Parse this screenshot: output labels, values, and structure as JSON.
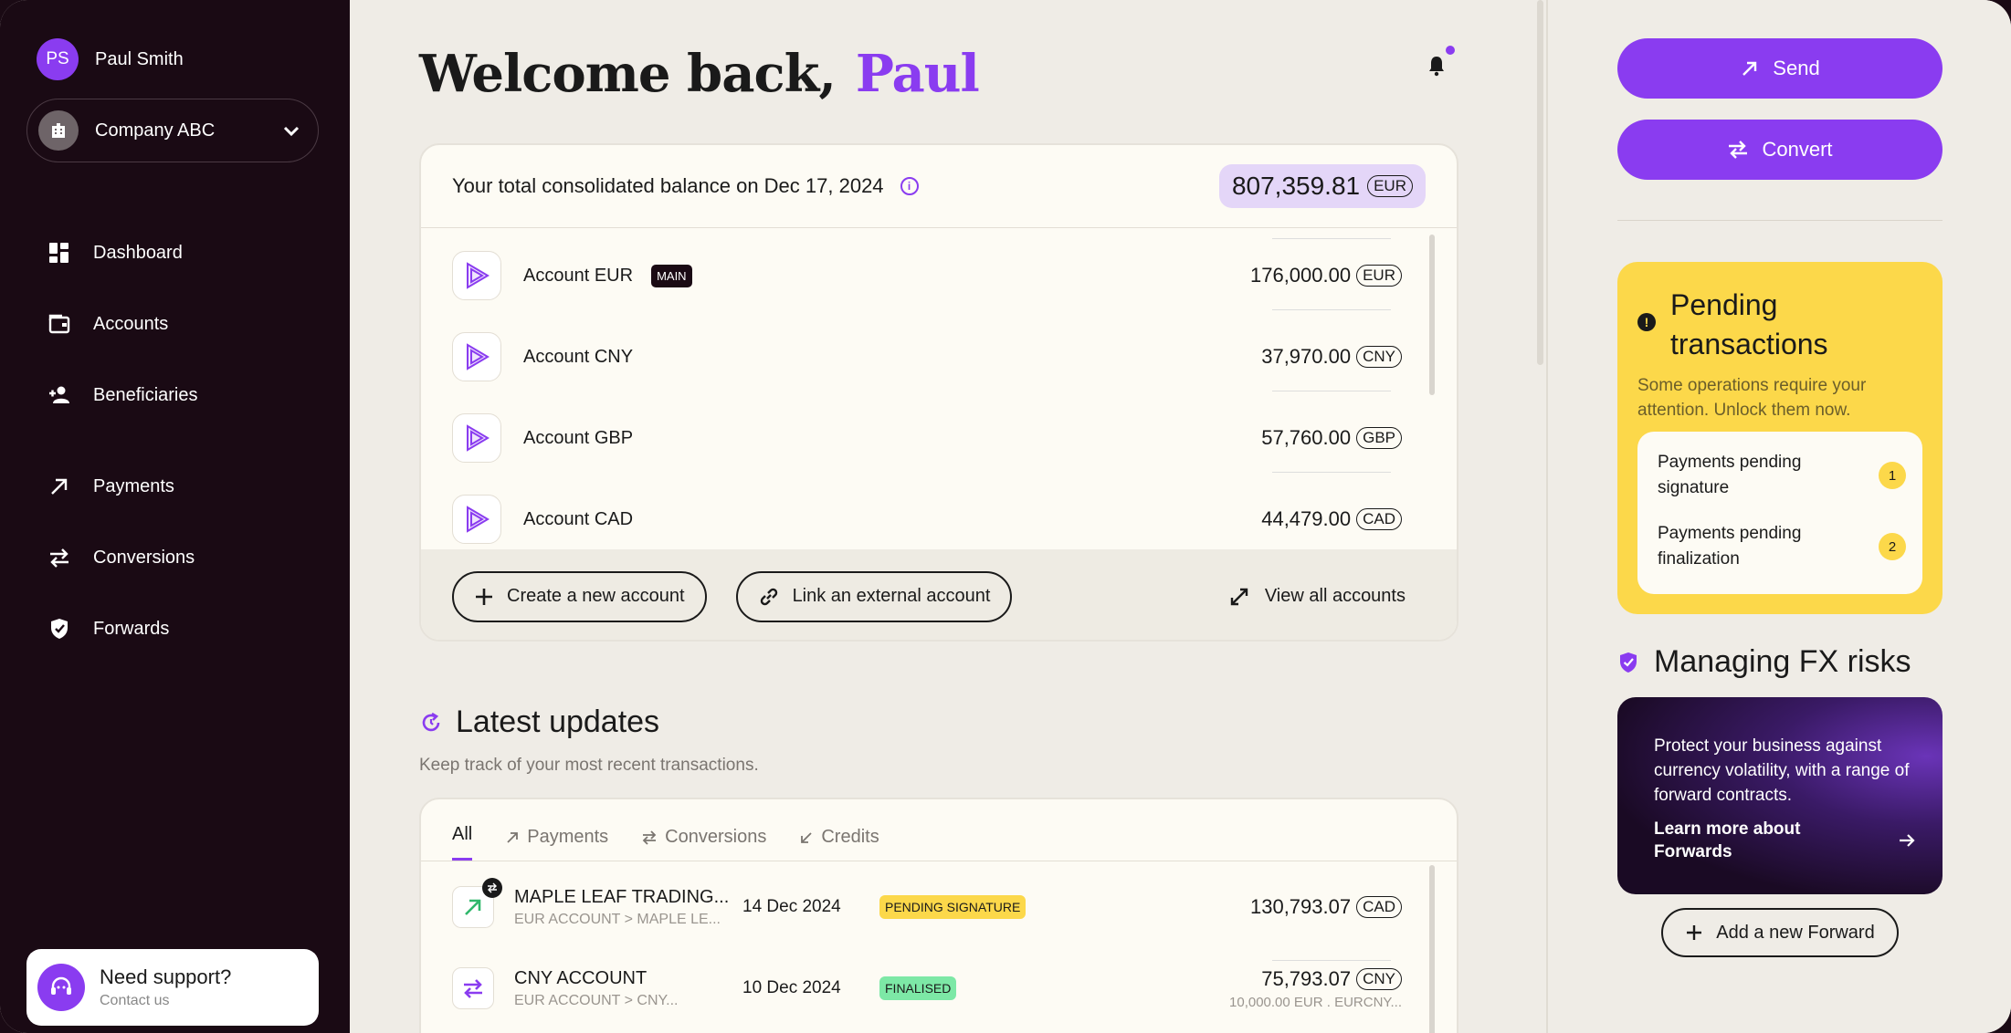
{
  "user": {
    "initials": "PS",
    "name": "Paul Smith"
  },
  "company": {
    "name": "Company ABC"
  },
  "nav": [
    {
      "label": "Dashboard"
    },
    {
      "label": "Accounts"
    },
    {
      "label": "Beneficiaries"
    },
    {
      "label": "Payments"
    },
    {
      "label": "Conversions"
    },
    {
      "label": "Forwards"
    }
  ],
  "support": {
    "title": "Need support?",
    "subtitle": "Contact us"
  },
  "header": {
    "welcome": "Welcome back,",
    "name": "Paul"
  },
  "balance": {
    "label": "Your total consolidated balance on Dec 17, 2024",
    "amount": "807,359.81",
    "currency": "EUR"
  },
  "accounts": [
    {
      "name": "Account EUR",
      "badge": "MAIN",
      "amount": "176,000.00",
      "currency": "EUR"
    },
    {
      "name": "Account CNY",
      "amount": "37,970.00",
      "currency": "CNY"
    },
    {
      "name": "Account GBP",
      "amount": "57,760.00",
      "currency": "GBP"
    },
    {
      "name": "Account CAD",
      "amount": "44,479.00",
      "currency": "CAD"
    }
  ],
  "account_actions": {
    "create": "Create a new account",
    "link": "Link an external account",
    "view_all": "View all accounts"
  },
  "updates": {
    "title": "Latest updates",
    "subtitle": "Keep track of your most recent transactions.",
    "tabs": [
      {
        "label": "All"
      },
      {
        "label": "Payments"
      },
      {
        "label": "Conversions"
      },
      {
        "label": "Credits"
      }
    ],
    "transactions": [
      {
        "name": "MAPLE LEAF TRADING...",
        "sub": "EUR ACCOUNT > MAPLE LE...",
        "date": "14 Dec 2024",
        "status": "PENDING SIGNATURE",
        "status_color": "#fcd84a",
        "amount": "130,793.07",
        "currency": "CAD",
        "amount_sub": ""
      },
      {
        "name": "CNY ACCOUNT",
        "sub": "EUR ACCOUNT > CNY...",
        "date": "10 Dec 2024",
        "status": "FINALISED",
        "status_color": "#7de8a6",
        "amount": "75,793.07",
        "currency": "CNY",
        "amount_sub": "10,000.00 EUR . EURCNY..."
      }
    ]
  },
  "actions": {
    "send": "Send",
    "convert": "Convert"
  },
  "pending": {
    "title_line1": "Pending",
    "title_line2": "transactions",
    "subtitle": "Some operations require your attention. Unlock them now.",
    "items": [
      {
        "label": "Payments pending signature",
        "count": "1"
      },
      {
        "label": "Payments pending finalization",
        "count": "2"
      }
    ]
  },
  "fx": {
    "title": "Managing FX risks",
    "text": "Protect your business against currency volatility, with a range of forward contracts.",
    "link": "Learn more about Forwards",
    "add_button": "Add a new Forward"
  },
  "colors": {
    "accent": "#8a3cf0",
    "sidebar": "#1a0a14",
    "pending_bg": "#fcd84a"
  }
}
